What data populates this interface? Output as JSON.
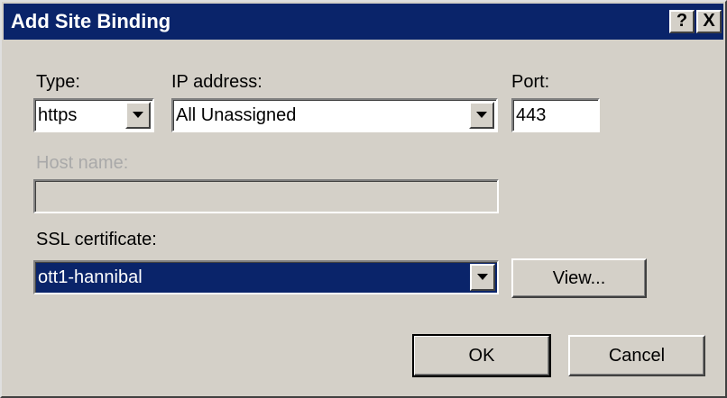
{
  "window": {
    "title": "Add Site Binding",
    "help_label": "?",
    "close_label": "X"
  },
  "type": {
    "label": "Type:",
    "value": "https"
  },
  "ip_address": {
    "label": "IP address:",
    "value": "All Unassigned"
  },
  "port": {
    "label": "Port:",
    "value": "443"
  },
  "host_name": {
    "label": "Host name:",
    "value": ""
  },
  "ssl_certificate": {
    "label": "SSL certificate:",
    "value": "ott1-hannibal"
  },
  "buttons": {
    "view": "View...",
    "ok": "OK",
    "cancel": "Cancel"
  },
  "colors": {
    "titlebar": "#0a246a",
    "face": "#d4d0c8",
    "selection": "#0a246a",
    "disabled_text": "#a9a9a9"
  },
  "icons": {
    "dropdown": "chevron-down-icon"
  }
}
